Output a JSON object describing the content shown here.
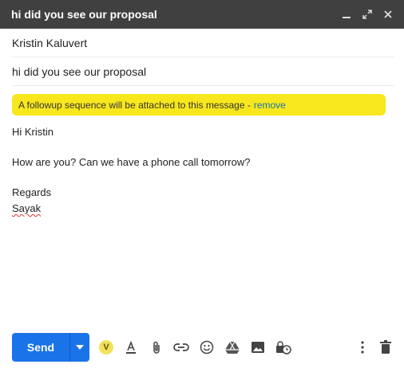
{
  "window": {
    "title": "hi did you see our proposal",
    "controls": [
      "minimize-icon",
      "expand-icon",
      "close-icon"
    ]
  },
  "compose": {
    "to": "Kristin Kaluvert",
    "subject": "hi did you see our proposal",
    "banner": {
      "text": "A followup sequence will be attached to this message -",
      "link": "remove",
      "color": "#f8e71c"
    },
    "body": {
      "greeting": "Hi Kristin",
      "message": "How are you? Can we have a phone call tomorrow?",
      "closing": "Regards",
      "signature": "Sayak"
    }
  },
  "toolbar": {
    "send_label": "Send",
    "extension_badge": "V",
    "accent": "#1a73e8",
    "icons": [
      "formatting-icon",
      "attach-icon",
      "link-icon",
      "emoji-icon",
      "drive-icon",
      "photo-icon",
      "confidential-icon",
      "more-options-icon",
      "delete-icon"
    ]
  }
}
